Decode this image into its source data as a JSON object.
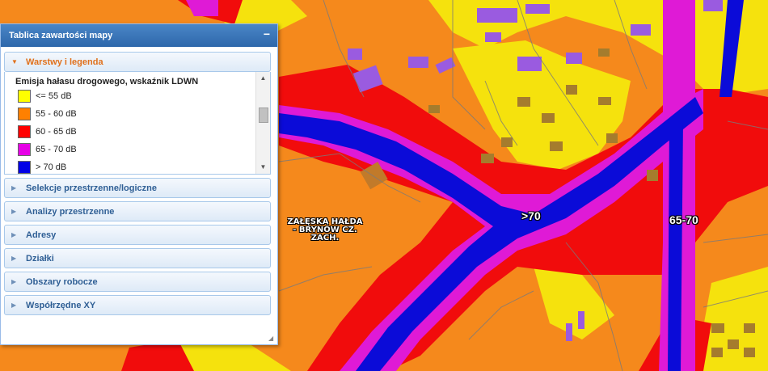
{
  "panel": {
    "title": "Tablica zawartości mapy",
    "collapse_icon": "−",
    "layers_section": "Warstwy i legenda",
    "legend": {
      "title": "Emisja hałasu drogowego, wskaźnik LDWN",
      "items": [
        {
          "label": "<= 55 dB",
          "color": "#ffff00"
        },
        {
          "label": "55 - 60 dB",
          "color": "#ff8000"
        },
        {
          "label": "60 - 65 dB",
          "color": "#ff0000"
        },
        {
          "label": "65 - 70 dB",
          "color": "#e600e6"
        },
        {
          "label": "> 70 dB",
          "color": "#0000e6"
        }
      ]
    },
    "sections": [
      "Selekcje przestrzenne/logiczne",
      "Analizy przestrzenne",
      "Adresy",
      "Działki",
      "Obszary robocze",
      "Współrzędne XY"
    ]
  },
  "map": {
    "place_label_line1": "ZAŁĘSKA  HAŁDA",
    "place_label_line2": "- BRYNÓW CZ. ZACH.",
    "noise_label_1": ">70",
    "noise_label_2": "65-70"
  }
}
